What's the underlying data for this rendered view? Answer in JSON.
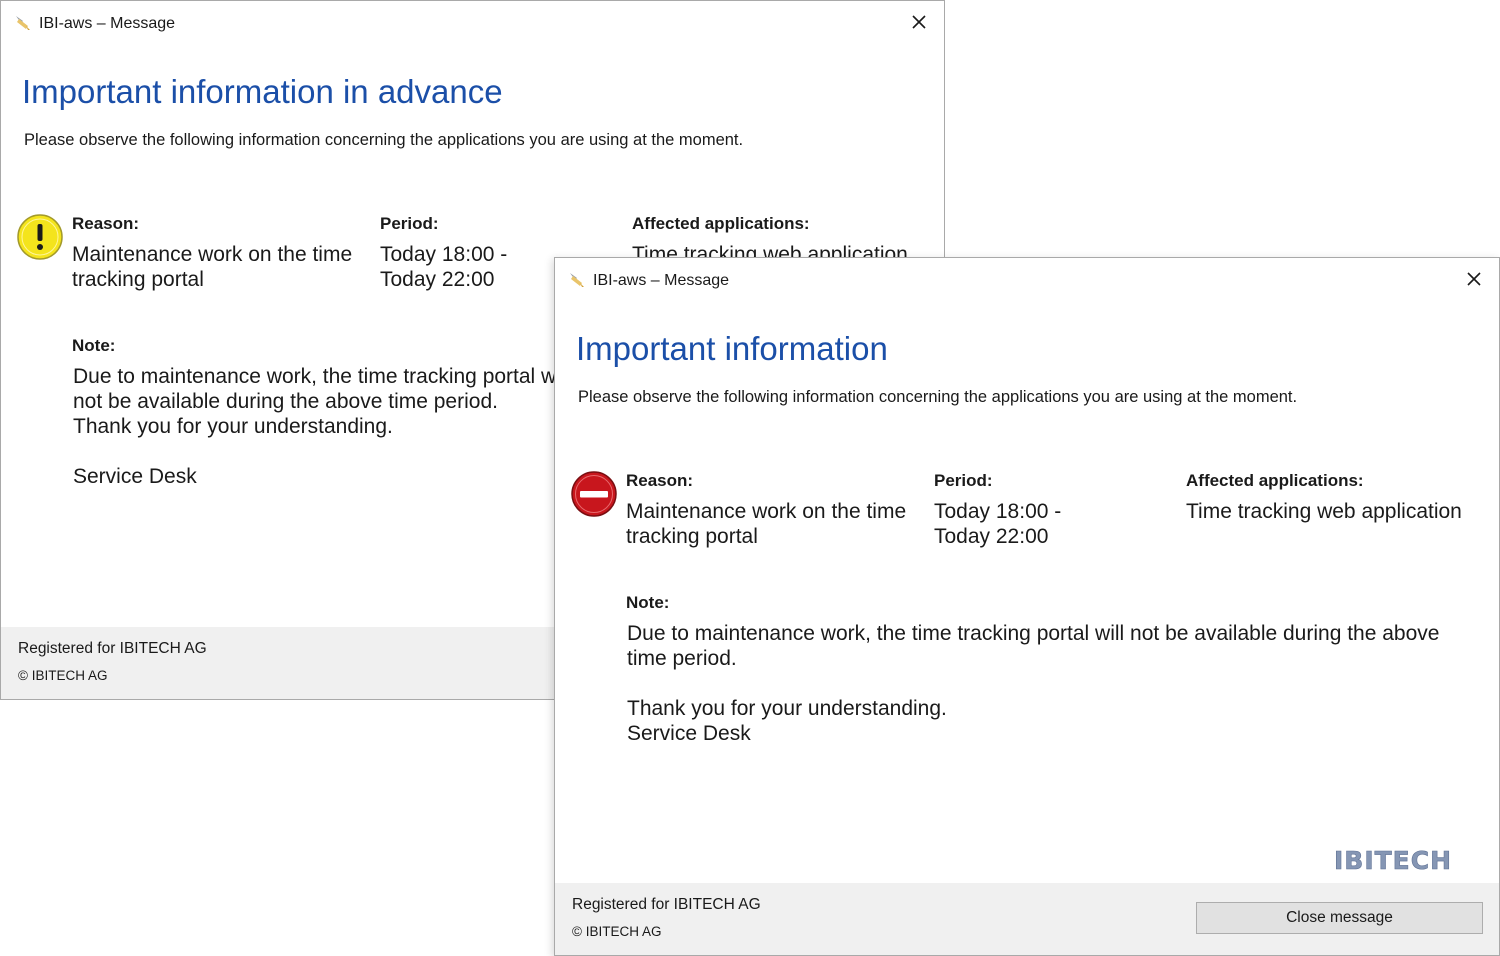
{
  "colors": {
    "heading": "#1b4fa8",
    "footer_bg": "#f0f0f0",
    "warning_fill": "#f4e41c",
    "stop_fill": "#c8161d",
    "logo_fill": "#8596b4"
  },
  "windows": [
    {
      "title": "IBI-aws – Message",
      "heading": "Important information in advance",
      "subtext": "Please observe the following information concerning the applications you are using at the moment.",
      "status_icon": "warning-icon",
      "reason_label": "Reason:",
      "reason_value": "Maintenance work on the time tracking portal",
      "period_label": "Period:",
      "period_line1": "Today 18:00 -",
      "period_line2": "Today 22:00",
      "affected_label": "Affected applications:",
      "affected_value": "Time tracking web application",
      "note_label": "Note:",
      "note_line1": "Due to maintenance work, the time tracking portal will not be available during the above time period.",
      "note_line2": "Thank you for your understanding.",
      "note_line3": "Service Desk",
      "footer_registered": "Registered for IBITECH AG",
      "footer_copyright": "© IBITECH AG"
    },
    {
      "title": "IBI-aws – Message",
      "heading": "Important information",
      "subtext": "Please observe the following information concerning the applications you are using at the moment.",
      "status_icon": "stop-icon",
      "reason_label": "Reason:",
      "reason_value": "Maintenance work on the time tracking portal",
      "period_label": "Period:",
      "period_line1": "Today 18:00 -",
      "period_line2": "Today 22:00",
      "affected_label": "Affected applications:",
      "affected_value": "Time tracking web application",
      "note_label": "Note:",
      "note_line1": "Due to maintenance work, the time tracking portal will not be available during the above time period.",
      "note_line2": "Thank you for your understanding.",
      "note_line3": "Service Desk",
      "logo_text": "IBITECH",
      "footer_registered": "Registered for IBITECH AG",
      "footer_copyright": "© IBITECH AG",
      "close_button_label": "Close message"
    }
  ]
}
